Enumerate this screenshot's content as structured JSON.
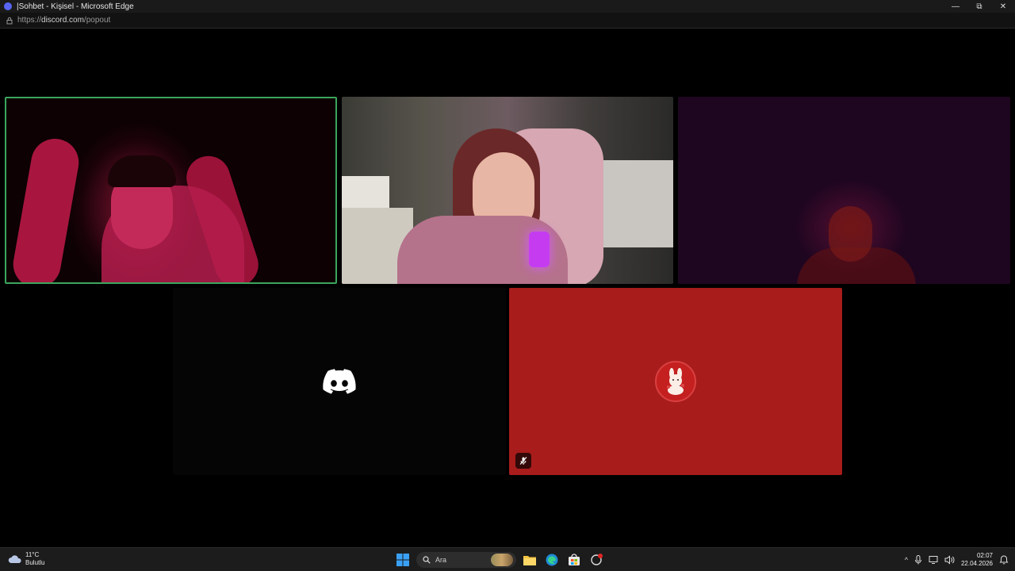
{
  "window": {
    "title": "|Sohbet - Kişisel - Microsoft Edge",
    "controls": {
      "minimize": "—",
      "restore": "⧉",
      "close": "✕"
    }
  },
  "address": {
    "url_prefix": "https://",
    "url_domain": "discord.com",
    "url_path": "/popout"
  },
  "call": {
    "tiles": [
      {
        "id": "participant-1",
        "type": "video",
        "speaking": true
      },
      {
        "id": "participant-2",
        "type": "video",
        "speaking": false
      },
      {
        "id": "participant-3",
        "type": "video",
        "speaking": false
      },
      {
        "id": "participant-4",
        "type": "avatar",
        "avatar_icon": "discord-logo-icon"
      },
      {
        "id": "participant-5",
        "type": "avatar",
        "avatar_icon": "bunny-avatar-icon",
        "muted": true,
        "background": "#a81c1c"
      }
    ],
    "speaking_color": "#3ba55d"
  },
  "taskbar": {
    "weather": {
      "temp": "11°C",
      "condition": "Bulutlu"
    },
    "search_placeholder": "Ara",
    "clock": {
      "time": "02:07",
      "date": "22.04.2026"
    }
  }
}
